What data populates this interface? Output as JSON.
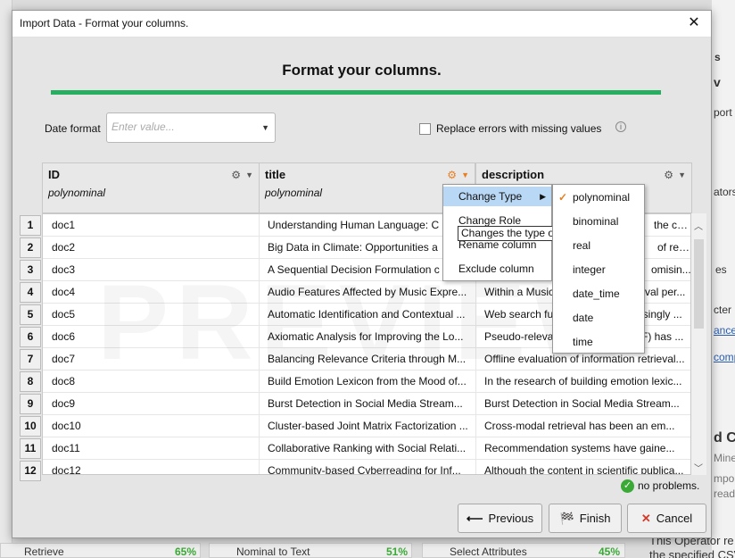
{
  "dialog": {
    "title": "Import Data - Format your columns.",
    "heading": "Format your columns."
  },
  "date_format": {
    "label": "Date format",
    "placeholder": "Enter value..."
  },
  "replace_errors_label": "Replace errors with missing values",
  "columns": [
    {
      "name": "ID",
      "role": "polynominal"
    },
    {
      "name": "title",
      "role": "polynominal"
    },
    {
      "name": "description",
      "role": ""
    }
  ],
  "rows": [
    {
      "n": "1",
      "id": "doc1",
      "title": "Understanding Human Language: C",
      "desc": "the cor..."
    },
    {
      "n": "2",
      "id": "doc2",
      "title": "Big Data in Climate: Opportunities a",
      "desc": "of res..."
    },
    {
      "n": "3",
      "id": "doc3",
      "title": "A Sequential Decision Formulation c",
      "desc": "omisin..."
    },
    {
      "n": "4",
      "id": "doc4",
      "title": "Audio Features Affected by Music Expre...",
      "desc": "Within a Music",
      "desc2": "val per..."
    },
    {
      "n": "5",
      "id": "doc5",
      "title": "Automatic Identification and Contextual ...",
      "desc": "Web search fu",
      "desc2": "asingly ..."
    },
    {
      "n": "6",
      "id": "doc6",
      "title": "Axiomatic Analysis for Improving the Lo...",
      "desc": "Pseudo-releva",
      "desc2": "F) has ..."
    },
    {
      "n": "7",
      "id": "doc7",
      "title": "Balancing Relevance Criteria through M...",
      "desc": "Offline evaluation of information retrieval..."
    },
    {
      "n": "8",
      "id": "doc8",
      "title": "Build Emotion Lexicon from the Mood of...",
      "desc": "In the research of building emotion lexic..."
    },
    {
      "n": "9",
      "id": "doc9",
      "title": "Burst Detection in Social Media Stream...",
      "desc": "Burst Detection in Social Media Stream..."
    },
    {
      "n": "10",
      "id": "doc10",
      "title": "Cluster-based Joint Matrix Factorization ...",
      "desc": "Cross-modal retrieval has been an em..."
    },
    {
      "n": "11",
      "id": "doc11",
      "title": "Collaborative Ranking with Social Relati...",
      "desc": "Recommendation systems have gaine..."
    },
    {
      "n": "12",
      "id": "doc12",
      "title": "Community-based Cyberreading for Inf...",
      "desc": "Although the content in scientific publica..."
    }
  ],
  "context_menu": {
    "items": [
      "Change Type",
      "Change Role",
      "Rename column",
      "Exclude column"
    ],
    "tooltip": "Changes the type of"
  },
  "type_submenu": {
    "items": [
      "polynominal",
      "binominal",
      "real",
      "integer",
      "date_time",
      "date",
      "time"
    ],
    "selected": "polynominal"
  },
  "status": {
    "text": "no problems."
  },
  "buttons": {
    "previous": "Previous",
    "finish": "Finish",
    "cancel": "Cancel"
  },
  "background": {
    "retrieve": "Retrieve",
    "retrieve_pct": "65%",
    "nominal": "Nominal to Text",
    "nominal_pct": "51%",
    "select": "Select Attributes",
    "select_pct": "45%",
    "right_lines": [
      "ators",
      "s",
      "v",
      "port C",
      "rators",
      "es",
      "cter",
      "ance",
      "comp",
      "d C",
      "Mine",
      "mpo",
      "read",
      "This Operator re",
      "the specified CSV"
    ]
  },
  "colors": {
    "accent_green": "#27ae60",
    "accent_orange": "#e67e22",
    "highlight": "#b9d8f5"
  }
}
